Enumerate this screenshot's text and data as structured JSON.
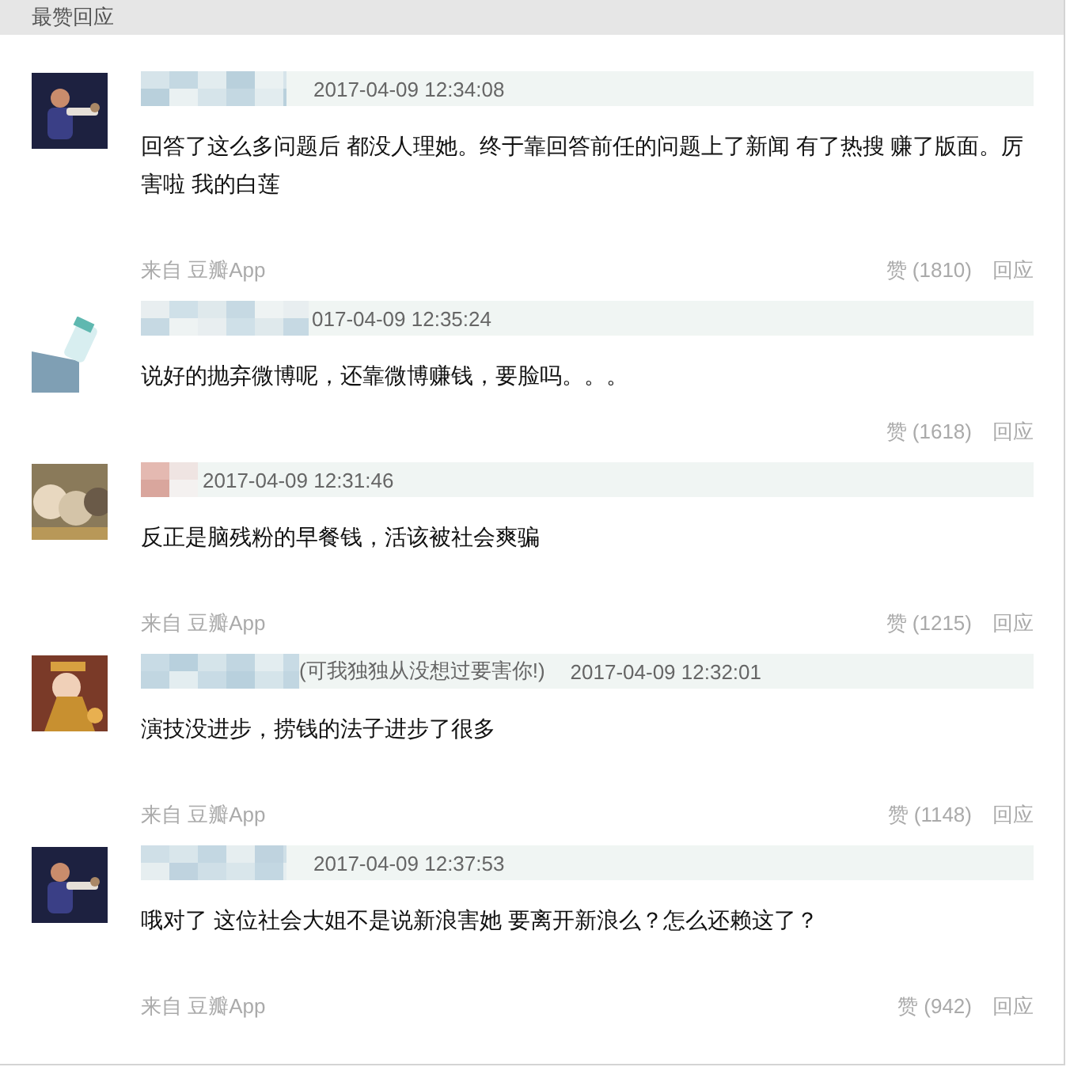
{
  "section_title": "最赞回应",
  "comments": [
    {
      "time": "2017-04-09 12:34:08",
      "text": "回答了这么多问题后 都没人理她。终于靠回答前任的问题上了新闻 有了热搜 赚了版面。厉害啦 我的白莲",
      "source": "来自 豆瓣App",
      "likes": "赞 (1810)",
      "reply": "回应"
    },
    {
      "time": "017-04-09 12:35:24",
      "text": "说好的抛弃微博呢，还靠微博赚钱，要脸吗。。。",
      "likes": "赞 (1618)",
      "reply": "回应"
    },
    {
      "time": "2017-04-09 12:31:46",
      "text": "反正是脑残粉的早餐钱，活该被社会爽骗",
      "source": "来自 豆瓣App",
      "likes": "赞 (1215)",
      "reply": "回应"
    },
    {
      "signature": "(可我独独从没想过要害你!)",
      "time": "2017-04-09 12:32:01",
      "text": "演技没进步，捞钱的法子进步了很多",
      "source": "来自 豆瓣App",
      "likes": "赞 (1148)",
      "reply": "回应"
    },
    {
      "time": "2017-04-09 12:37:53",
      "text": "哦对了 这位社会大姐不是说新浪害她 要离开新浪么？怎么还赖这了？",
      "source": "来自 豆瓣App",
      "likes": "赞 (942)",
      "reply": "回应"
    }
  ]
}
